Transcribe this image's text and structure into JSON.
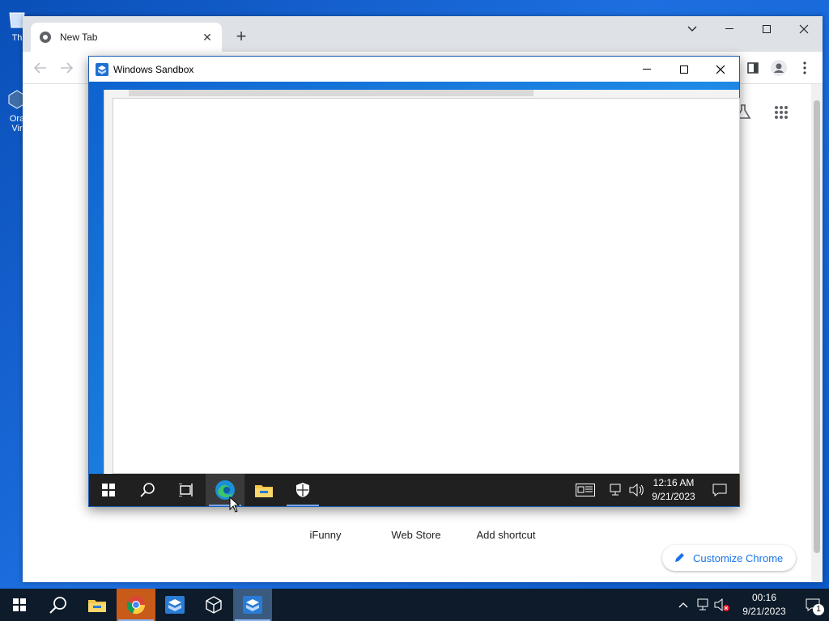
{
  "desktop": {
    "icons": [
      {
        "label": "Th"
      },
      {
        "label": "Ora Vir"
      }
    ]
  },
  "chrome": {
    "tab_title": "New Tab",
    "new_tab": "+",
    "shortcuts": [
      "iFunny",
      "Web Store",
      "Add shortcut"
    ],
    "customize_label": "Customize Chrome",
    "accent": "#1a73e8"
  },
  "sandbox": {
    "title": "Windows Sandbox",
    "clock_time": "12:16 AM",
    "clock_date": "9/21/2023"
  },
  "taskbar": {
    "clock_time": "00:16",
    "clock_date": "9/21/2023",
    "notification_count": "1"
  }
}
